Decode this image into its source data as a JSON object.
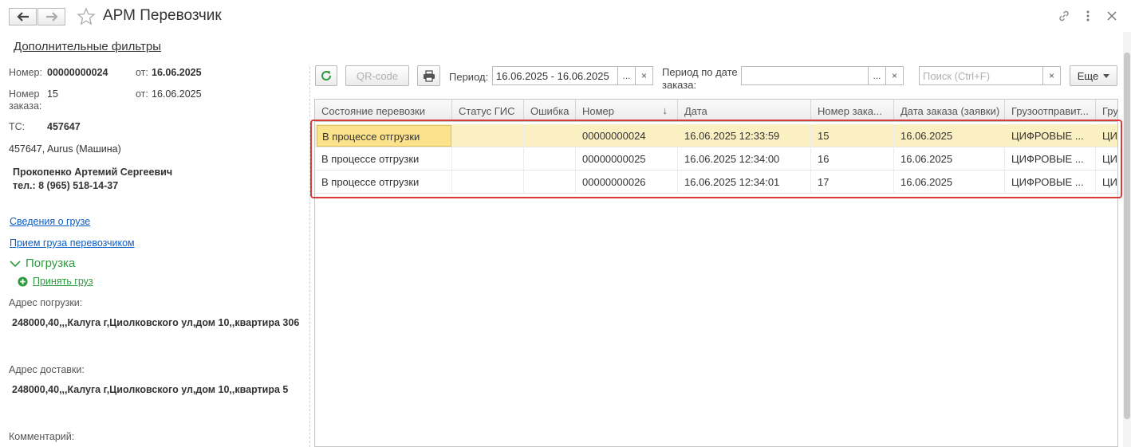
{
  "window": {
    "title": "АРМ Перевозчик"
  },
  "left": {
    "filters_link": "Дополнительные фильтры",
    "number_label": "Номер:",
    "number_value": "00000000024",
    "from_label": "от:",
    "number_date": "16.06.2025",
    "order_label": "Номер заказа:",
    "order_value": "15",
    "order_from_label": "от:",
    "order_date": "16.06.2025",
    "ts_label": "ТС:",
    "ts_value": "457647",
    "vehicle": "457647, Aurus (Машина)",
    "driver_name": "Прокопенко Артемий Сергеевич",
    "driver_phone": "тел.: 8 (965) 518-14-37",
    "cargo_info_link": "Сведения о грузе",
    "cargo_accept_link": "Прием груза перевозчиком",
    "loading_section": "Погрузка",
    "accept_cargo_link": "Принять груз",
    "loading_address_label": "Адрес погрузки:",
    "loading_address": "248000,40,,,Калуга г,Циолковского ул,дом 10,,квартира 306",
    "delivery_address_label": "Адрес доставки:",
    "delivery_address": "248000,40,,,Калуга г,Циолковского ул,дом 10,,квартира 5",
    "comment_label": "Комментарий:"
  },
  "toolbar": {
    "qr_label": "QR-code",
    "period_label": "Период:",
    "period_value": "16.06.2025 - 16.06.2025",
    "period_order_label_1": "Период по дате",
    "period_order_label_2": "заказа:",
    "period_order_value": "",
    "search_placeholder": "Поиск (Ctrl+F)",
    "more_label": "Еще",
    "ellipsis": "...",
    "clear": "×"
  },
  "grid": {
    "columns": [
      "Состояние перевозки",
      "Статус ГИС",
      "Ошибка",
      "Номер",
      "Дата",
      "Номер зака...",
      "Дата заказа (заявки)",
      "Грузоотправит...",
      "Гру"
    ],
    "sort_indicator": "↓",
    "rows": [
      [
        "В процессе отгрузки",
        "",
        "",
        "00000000024",
        "16.06.2025 12:33:59",
        "15",
        "16.06.2025",
        "ЦИФРОВЫЕ ...",
        "ЦИ"
      ],
      [
        "В процессе отгрузки",
        "",
        "",
        "00000000025",
        "16.06.2025 12:34:00",
        "16",
        "16.06.2025",
        "ЦИФРОВЫЕ ...",
        "ЦИ"
      ],
      [
        "В процессе отгрузки",
        "",
        "",
        "00000000026",
        "16.06.2025 12:34:01",
        "17",
        "16.06.2025",
        "ЦИФРОВЫЕ ...",
        "ЦИ"
      ]
    ]
  },
  "colors": {
    "accent_green": "#2c9a3e",
    "link_blue": "#0b5ec6",
    "selected_row": "#fbf0c2",
    "highlight_red": "#d93a3a"
  }
}
